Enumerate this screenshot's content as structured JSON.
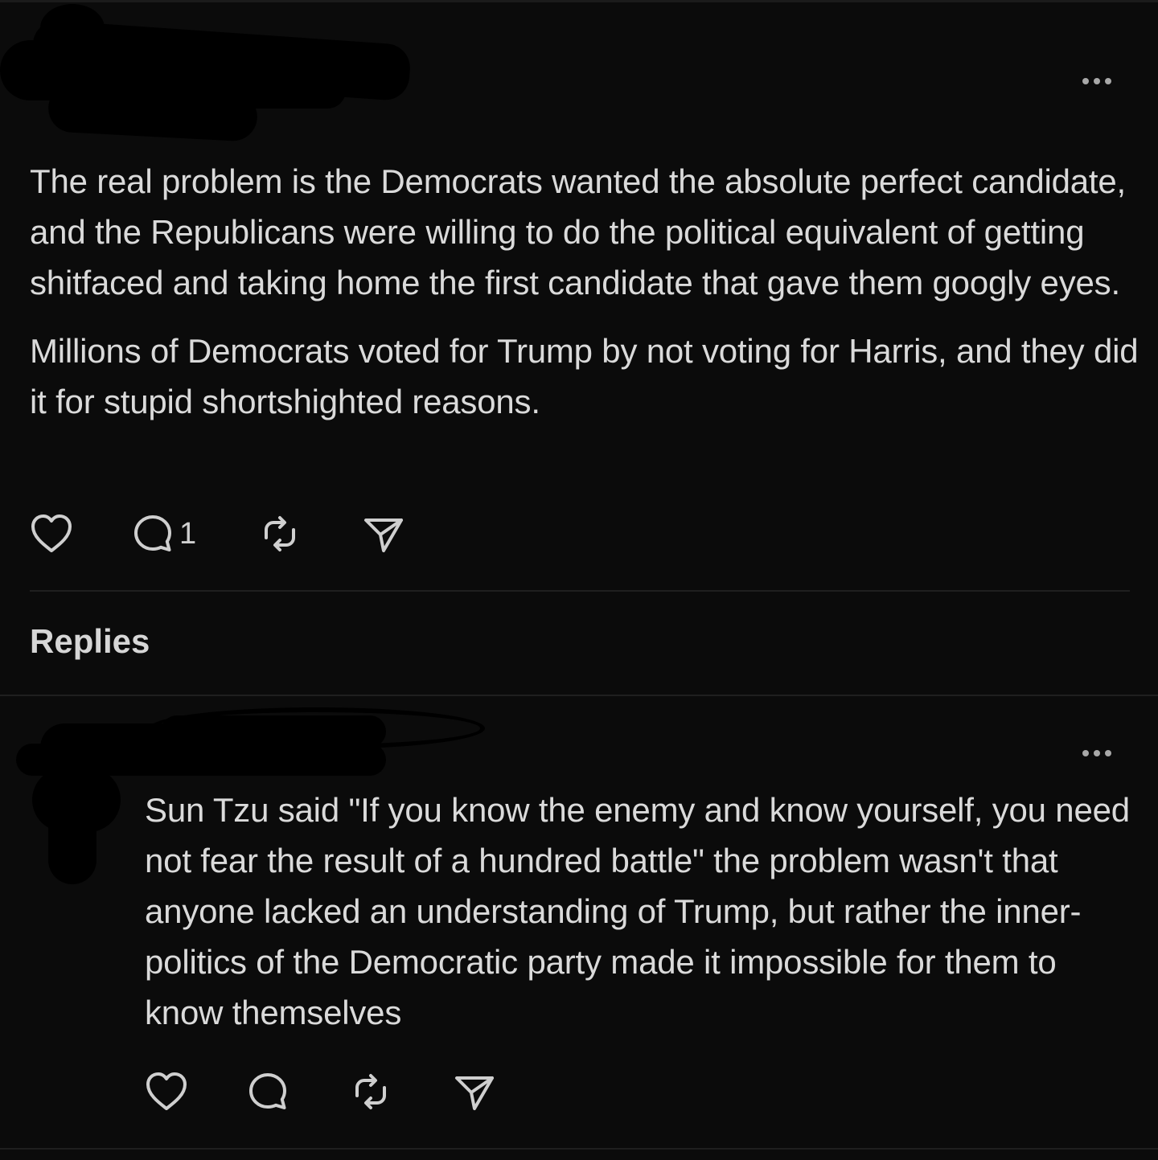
{
  "post": {
    "paragraphs": [
      "The real problem is the Democrats wanted the absolute perfect candidate, and the Republicans were willing to do the political equivalent of getting shitfaced and taking home the first candidate that gave them googly eyes.",
      "Millions of Democrats voted for Trump by not voting for Harris, and they did it for stupid shortshighted reasons."
    ],
    "reply_count": "1",
    "icons": {
      "like": "heart-icon",
      "reply": "comment-icon",
      "repost": "repost-icon",
      "share": "send-icon",
      "more": "more-icon"
    }
  },
  "replies_heading": "Replies",
  "reply": {
    "text": "Sun Tzu said \"If you know the enemy and know yourself, you need not fear the result of a hundred battle\" the problem wasn't that anyone lacked an understanding of Trump, but rather the inner-politics of the Democratic party made it impossible for them to know themselves"
  },
  "colors": {
    "background": "#0b0b0b",
    "text": "#dadada",
    "icon": "#cfcfcf",
    "divider": "#1f1f1f"
  }
}
